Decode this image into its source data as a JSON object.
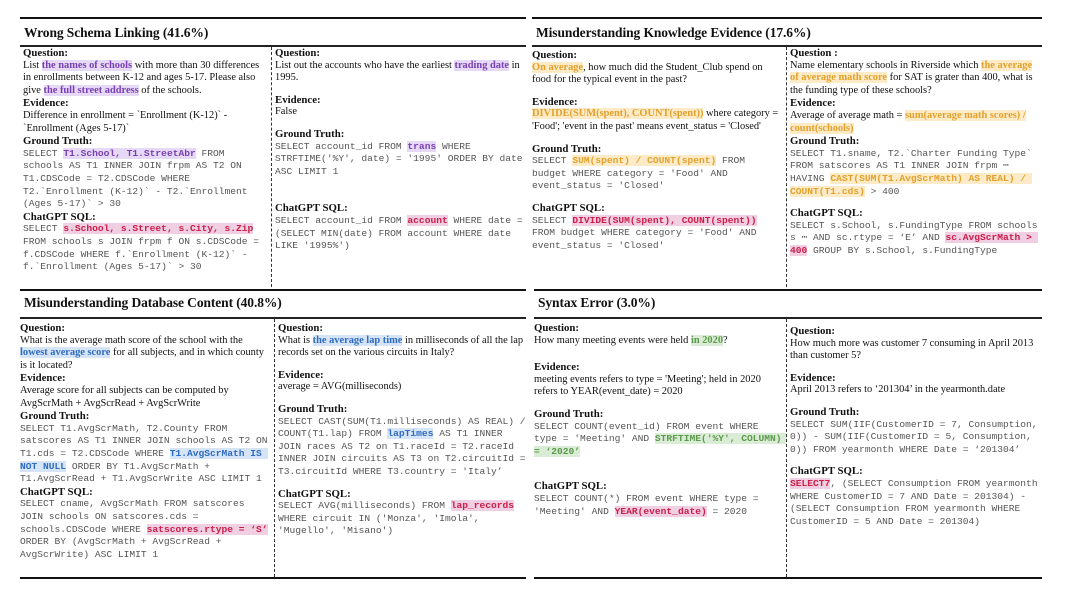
{
  "panels": {
    "schema": {
      "title": "Wrong Schema Linking (41.6%)",
      "left": {
        "question_label": "Question:",
        "question": [
          "List ",
          "the names of schools",
          " with more than 30 differences in enrollments between K-12 and ages 5-17. Please also give ",
          "the full street address",
          " of the schools."
        ],
        "evidence_label": "Evidence:",
        "evidence": "Difference in enrollment = `Enrollment (K-12)` - `Enrollment (Ages 5-17)`",
        "gt_label": "Ground Truth:",
        "gt": [
          "SELECT ",
          "T1.School, T1.StreetAbr",
          " FROM schools AS T1 INNER JOIN frpm AS T2 ON T1.CDSCode = T2.CDSCode WHERE T2.`Enrollment (K-12)` - T2.`Enrollment (Ages 5-17)` > 30"
        ],
        "gpt_label": "ChatGPT SQL:",
        "gpt": [
          "SELECT ",
          "s.School, s.Street, s.City, s.Zip",
          " FROM schools s JOIN frpm f ON s.CDSCode = f.CDSCode WHERE f.`Enrollment (K-12)` - f.`Enrollment (Ages 5-17)` > 30"
        ]
      },
      "right": {
        "question_label": "Question:",
        "question": [
          "List out the accounts who have the earliest ",
          "trading date",
          " in 1995."
        ],
        "evidence_label": "Evidence:",
        "evidence": "False",
        "gt_label": "Ground Truth:",
        "gt": [
          "SELECT account_id FROM ",
          "trans",
          " WHERE STRFTIME('%Y', date) = '1995' ORDER BY date ASC LIMIT 1"
        ],
        "gpt_label": "ChatGPT SQL:",
        "gpt": [
          "SELECT account_id FROM ",
          "account",
          " WHERE date = (SELECT MIN(date) FROM account WHERE date LIKE '1995%')"
        ]
      }
    },
    "knowledge": {
      "title": "Misunderstanding Knowledge Evidence (17.6%)",
      "left": {
        "question_label": "Question:",
        "question": [
          "",
          "On average",
          ", how much did the Student_Club spend on food for the typical event in the past?"
        ],
        "evidence_label": "Evidence:",
        "evidence": [
          "",
          "DIVIDE(SUM(spent), COUNT(spent))",
          " where category = 'Food'; 'event in the past' means event_status = 'Closed'"
        ],
        "gt_label": "Ground Truth:",
        "gt": [
          "SELECT ",
          "SUM(spent) / COUNT(spent)",
          " FROM budget WHERE category = 'Food' AND event_status = 'Closed'"
        ],
        "gpt_label": "ChatGPT SQL:",
        "gpt": [
          "SELECT ",
          "DIVIDE(SUM(spent), COUNT(spent))",
          " FROM budget WHERE category = 'Food' AND event_status = 'Closed'"
        ]
      },
      "right": {
        "question_label": "Question :",
        "question": [
          "Name elementary schools in Riverside which ",
          "the average of average math score",
          " for SAT is grater than 400, what is the funding type of these schools?"
        ],
        "evidence_label": "Evidence:",
        "evidence": [
          "Average of average math = ",
          "sum(average math scores) / count(schools)",
          ""
        ],
        "gt_label": "Ground Truth:",
        "gt": [
          "SELECT T1.sname, T2.`Charter Funding Type` FROM satscores AS T1 INNER JOIN frpm ⋯ HAVING ",
          "CAST(SUM(T1.AvgScrMath) AS REAL) / COUNT(T1.cds)",
          " > 400"
        ],
        "gpt_label": "ChatGPT SQL:",
        "gpt": [
          "SELECT s.School, s.FundingType FROM schools s ⋯ AND sc.rtype = ‘E’ AND ",
          "sc.AvgScrMath > 400",
          " GROUP BY s.School, s.FundingType"
        ]
      }
    },
    "content": {
      "title": "Misunderstanding Database Content (40.8%)",
      "left": {
        "question_label": "Question:",
        "question": [
          "What is the average math score of the school with the ",
          "lowest average score",
          " for all subjects, and in which county is it located?"
        ],
        "evidence_label": "Evidence:",
        "evidence": "Average score for all subjects can be computed by AvgScrMath + AvgScrRead + AvgScrWrite",
        "gt_label": "Ground Truth:",
        "gt": [
          "SELECT T1.AvgScrMath, T2.County FROM satscores AS T1 INNER JOIN schools AS T2 ON T1.cds = T2.CDSCode WHERE ",
          "T1.AvgScrMath IS NOT NULL",
          " ORDER BY T1.AvgScrMath + T1.AvgScrRead + T1.AvgScrWrite ASC LIMIT 1"
        ],
        "gpt_label": "ChatGPT SQL:",
        "gpt": [
          "SELECT cname, AvgScrMath FROM satscores JOIN schools ON satscores.cds = schools.CDSCode WHERE ",
          "satscores.rtype = ‘S’",
          " ORDER BY (AvgScrMath + AvgScrRead + AvgScrWrite) ASC LIMIT 1"
        ]
      },
      "right": {
        "question_label": "Question:",
        "question": [
          "What is ",
          "the average lap time",
          " in milliseconds of all the lap records set on the various circuits in Italy?"
        ],
        "evidence_label": "Evidence:",
        "evidence": "average = AVG(milliseconds)",
        "gt_label": "Ground Truth:",
        "gt": [
          "SELECT CAST(SUM(T1.milliseconds) AS REAL) / COUNT(T1.lap) FROM ",
          "lapTimes",
          " AS T1 INNER JOIN races AS T2 on T1.raceId = T2.raceId INNER JOIN circuits AS T3 on T2.circuitId = T3.circuitId WHERE T3.country = 'Italy’"
        ],
        "gpt_label": "ChatGPT SQL:",
        "gpt": [
          "SELECT AVG(milliseconds) FROM ",
          "lap_records",
          " WHERE circuit IN ('Monza', 'Imola', 'Mugello', 'Misano')"
        ]
      }
    },
    "syntax": {
      "title": "Syntax Error (3.0%)",
      "left": {
        "question_label": "Question:",
        "question": [
          "How many meeting events were held ",
          "in 2020",
          "?"
        ],
        "evidence_label": "Evidence:",
        "evidence": "meeting events refers to type = 'Meeting'; held in 2020 refers to YEAR(event_date) = 2020",
        "gt_label": "Ground Truth:",
        "gt": [
          "SELECT COUNT(event_id) FROM event WHERE type = 'Meeting' AND ",
          "STRFTIME('%Y', COLUMN) = ‘2020’",
          ""
        ],
        "gpt_label": "ChatGPT SQL:",
        "gpt": [
          "SELECT COUNT(*) FROM event WHERE type = 'Meeting' AND ",
          "YEAR(event_date)",
          " = 2020"
        ]
      },
      "right": {
        "question_label": "Question:",
        "question": "How much more was customer 7 consuming in April 2013 than customer 5?",
        "evidence_label": "Evidence:",
        "evidence": "April 2013 refers to ‘201304’ in the yearmonth.date",
        "gt_label": "Ground Truth:",
        "gt": "SELECT SUM(IIF(CustomerID = 7, Consumption, 0)) - SUM(IIF(CustomerID = 5, Consumption, 0)) FROM yearmonth WHERE Date = ‘201304’",
        "gpt_label": "ChatGPT SQL:",
        "gpt": [
          "",
          "SELECT7",
          ", (SELECT Consumption FROM yearmonth WHERE CustomerID = 7 AND Date = 201304) - (SELECT Consumption FROM yearmonth WHERE CustomerID = 5 AND Date = 201304)"
        ]
      }
    }
  }
}
